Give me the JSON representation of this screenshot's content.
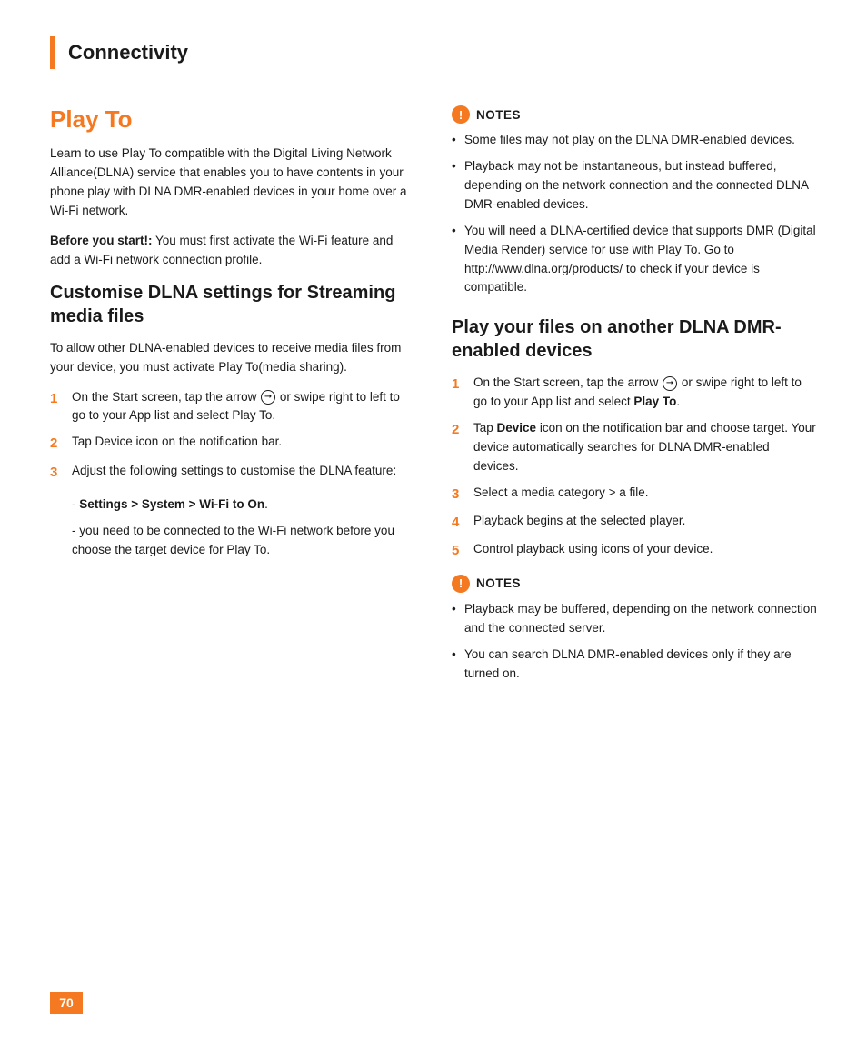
{
  "header": {
    "title": "Connectivity",
    "bar_color": "#f47920"
  },
  "left_column": {
    "main_title": "Play To",
    "intro_text": "Learn to use Play To compatible with the Digital Living Network Alliance(DLNA) service that enables you to have contents in your phone play with DLNA DMR-enabled devices in your home over a Wi-Fi network.",
    "before_start": "Before you start!:",
    "before_start_text": " You must first activate the Wi-Fi feature and add a Wi-Fi network connection profile.",
    "customise_title": "Customise DLNA settings for Streaming media files",
    "customise_intro": "To allow other DLNA-enabled devices to receive media files from your device, you must activate Play To(media sharing).",
    "steps": [
      {
        "num": "1",
        "text": "On the Start screen, tap the arrow",
        "has_icon": true,
        "after_icon": " or swipe right to left to go to your App list and select Play To."
      },
      {
        "num": "2",
        "text": "Tap Device icon on the notification bar.",
        "has_icon": false,
        "after_icon": ""
      },
      {
        "num": "3",
        "text": "Adjust the following settings to customise the DLNA feature:",
        "has_icon": false,
        "after_icon": ""
      }
    ],
    "sub_steps": [
      {
        "prefix": "- ",
        "bold_text": "Settings > System > Wi-Fi  to On",
        "text": ""
      },
      {
        "prefix": "- ",
        "bold_text": "",
        "text": "you need to be connected to the Wi-Fi network before you choose the target device for Play To."
      }
    ]
  },
  "right_column": {
    "notes_title": "NOTES",
    "notes_items": [
      "Some files may not play on the DLNA DMR-enabled devices.",
      "Playback may not be instantaneous, but instead buffered, depending on the network connection and the connected DLNA DMR-enabled devices.",
      "You will need a DLNA-certified device that supports DMR (Digital Media Render) service for use with Play To. Go to http://www.dlna.org/products/ to check if your device is compatible."
    ],
    "play_files_title": "Play your files on another DLNA DMR-enabled devices",
    "play_steps": [
      {
        "num": "1",
        "text": "On the Start screen, tap the arrow",
        "has_icon": true,
        "after_icon": " or swipe right to left to go to your App list and select ",
        "bold_end": "Play To",
        "after_bold": "."
      },
      {
        "num": "2",
        "text": "Tap ",
        "bold_text": "Device",
        "after_bold": " icon on the notification bar and choose target. Your device automatically searches for DLNA DMR-enabled devices.",
        "has_icon": false
      },
      {
        "num": "3",
        "text": "Select a media category > a file.",
        "has_icon": false,
        "after_icon": ""
      },
      {
        "num": "4",
        "text": "Playback begins at the selected player.",
        "has_icon": false,
        "after_icon": ""
      },
      {
        "num": "5",
        "text": "Control playback using icons of your device.",
        "has_icon": false,
        "after_icon": ""
      }
    ],
    "notes2_title": "NOTES",
    "notes2_items": [
      "Playback may be buffered, depending on the network connection and the connected server.",
      "You can search DLNA DMR-enabled devices only if they are turned on."
    ]
  },
  "footer": {
    "page_number": "70"
  }
}
